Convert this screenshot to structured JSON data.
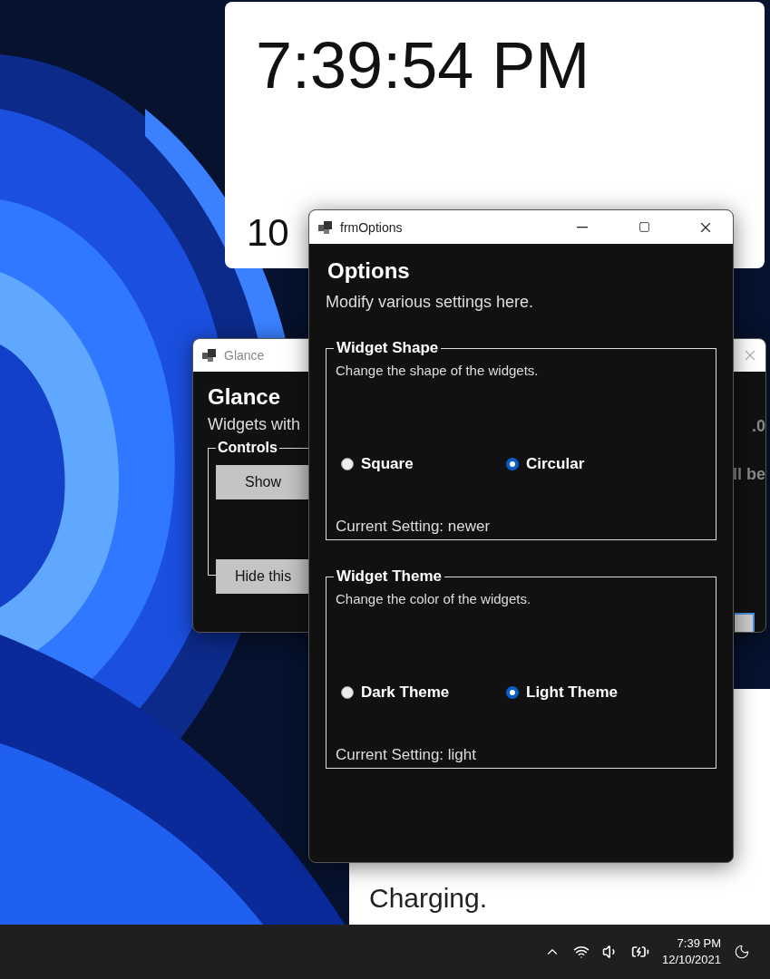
{
  "clock_widget": {
    "time": "7:39:54 PM",
    "date": "10"
  },
  "battery_widget": {
    "status": "Charging."
  },
  "glance_window": {
    "title": "Glance",
    "heading": "Glance",
    "subtitle": "Widgets with",
    "controls_group": {
      "legend": "Controls",
      "buttons": [
        "Show",
        "Hide this"
      ]
    },
    "fragment_1": ".0",
    "fragment_2": "ll be"
  },
  "options_window": {
    "title": "frmOptions",
    "heading": "Options",
    "subtitle": "Modify various settings here.",
    "groups": [
      {
        "legend": "Widget Shape",
        "description": "Change the shape of the widgets.",
        "options": [
          {
            "label": "Square",
            "selected": false
          },
          {
            "label": "Circular",
            "selected": true
          }
        ],
        "current": "Current Setting: newer"
      },
      {
        "legend": "Widget Theme",
        "description": "Change the color of the widgets.",
        "options": [
          {
            "label": "Dark Theme",
            "selected": false
          },
          {
            "label": "Light Theme",
            "selected": true
          }
        ],
        "current": "Current Setting: light"
      }
    ]
  },
  "taskbar": {
    "time": "7:39 PM",
    "date": "12/10/2021"
  }
}
